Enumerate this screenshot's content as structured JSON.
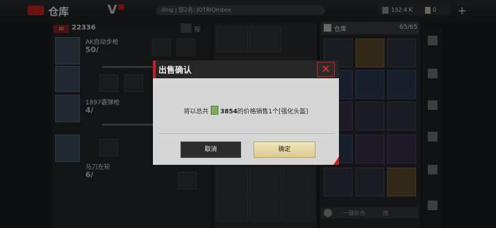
{
  "header": {
    "title": "仓库",
    "player_info": "ding | 部2名: JOTRIQmbex",
    "currency_1": "152.4 K",
    "currency_2": "0",
    "plus": "+"
  },
  "left_panel": {
    "id_badge": "ID",
    "id_value": "22336",
    "sort_label": "按",
    "characters": [
      {
        "name": "AK自动步枪",
        "count": "50/"
      },
      {
        "name": "1897霰弹枪",
        "count": "4/"
      },
      {
        "name": "马刀左轮",
        "count": "6/"
      }
    ]
  },
  "warehouse": {
    "label": "仓库",
    "count": "65/65",
    "bottom_left": "一键存合",
    "bottom_right": "按"
  },
  "dialog": {
    "title": "出售确认",
    "message_prefix": "将以总共",
    "price": "3854",
    "message_suffix": "的价格销售1个[强化头盔]",
    "cancel": "取消",
    "confirm": "确定",
    "close_symbol": "✕"
  },
  "colors": {
    "accent_red": "#c8201e",
    "confirm_gold": "#e5d9a4"
  }
}
